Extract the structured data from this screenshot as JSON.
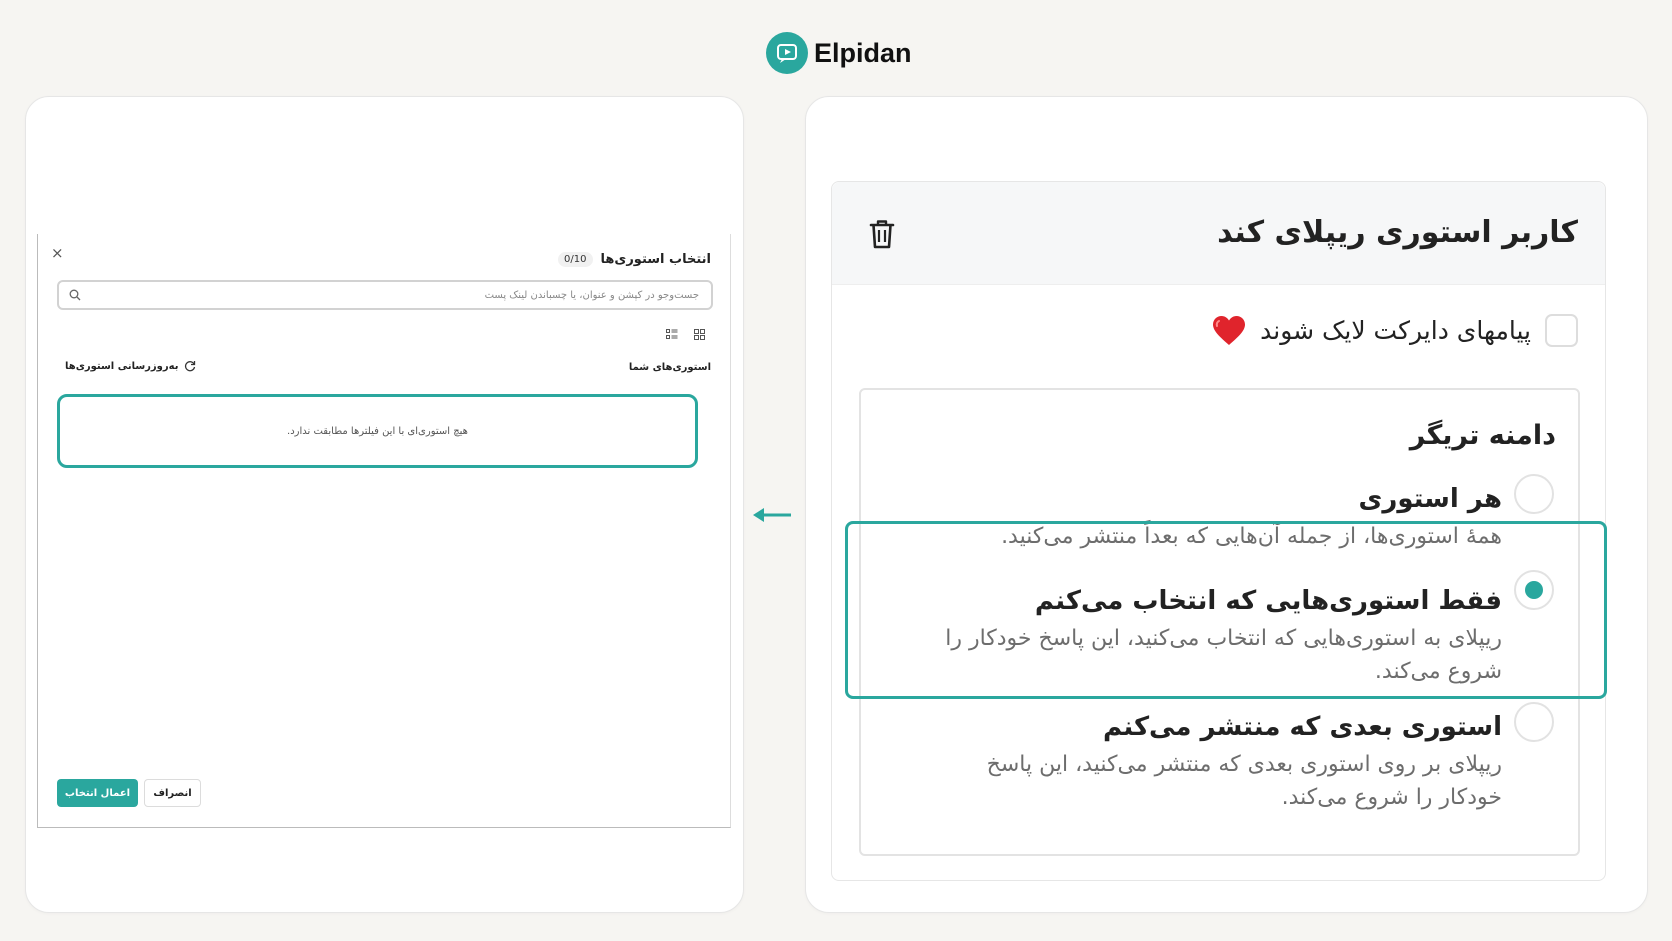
{
  "brand": {
    "name": "Elpidan",
    "logo_icon": "play-bubble-icon",
    "accent_color": "#2aa79e"
  },
  "story_picker": {
    "title": "انتخاب استوری‌ها",
    "count": "0/10",
    "close_label": "×",
    "search_placeholder": "جست‌وجو در کپشن و عنوان، یا چسباندن لینک پست",
    "section_label": "استوری‌های شما",
    "refresh_label": "به‌روزرسانی استوری‌ها",
    "empty_message": "هیچ استوری‌ای با این فیلترها مطابقت ندارد.",
    "apply_label": "اعمال انتخاب",
    "cancel_label": "انصراف"
  },
  "trigger": {
    "title": "کاربر استوری ریپلای کند",
    "like_dm_label": "پیامهای دایرکت لایک شوند",
    "like_dm_checked": false,
    "scope_title": "دامنه تریگر",
    "options": [
      {
        "title": "هر استوری",
        "desc_lines": [
          "همهٔ استوری‌ها، از جمله آن‌هایی که بعداً منتشر می‌کنید."
        ],
        "selected": false
      },
      {
        "title": "فقط استوری‌هایی که انتخاب می‌کنم",
        "desc_lines": [
          "ریپلای به استوری‌هایی که انتخاب می‌کنید، این پاسخ خودکار را",
          "شروع می‌کند."
        ],
        "selected": true
      },
      {
        "title": "استوری بعدی که منتشر می‌کنم",
        "desc_lines": [
          "ریپلای بر روی استوری بعدی که منتشر می‌کنید، این پاسخ",
          "خودکار را شروع می‌کند."
        ],
        "selected": false
      }
    ]
  }
}
